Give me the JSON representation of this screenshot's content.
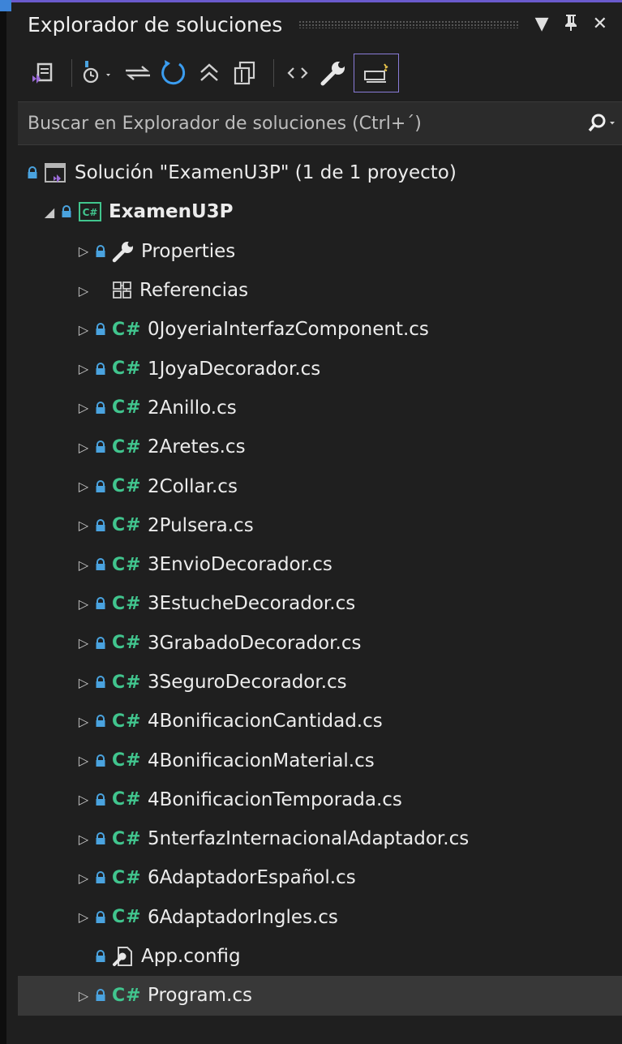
{
  "window": {
    "title": "Explorador de soluciones",
    "controls": {
      "dropdown": "▼",
      "pin": "🖈",
      "close": "✕"
    }
  },
  "toolbar": {
    "buttons": [
      "vs-solution-icon",
      "pending-changes-icon",
      "sync-icon",
      "refresh-icon",
      "collapse-all-icon",
      "show-all-files-icon",
      "code-view-icon",
      "properties-wrench-icon",
      "preview-selected-icon"
    ]
  },
  "search": {
    "placeholder": "Buscar en Explorador de soluciones (Ctrl+´)"
  },
  "tree": {
    "solution": "Solución \"ExamenU3P\"  (1 de 1 proyecto)",
    "project": "ExamenU3P",
    "properties": "Properties",
    "references": "Referencias",
    "cs_prefix": "C#",
    "files": [
      "0JoyeriaInterfazComponent.cs",
      "1JoyaDecorador.cs",
      "2Anillo.cs",
      "2Aretes.cs",
      "2Collar.cs",
      "2Pulsera.cs",
      "3EnvioDecorador.cs",
      "3EstucheDecorador.cs",
      "3GrabadoDecorador.cs",
      "3SeguroDecorador.cs",
      "4BonificacionCantidad.cs",
      "4BonificacionMaterial.cs",
      "4BonificacionTemporada.cs",
      "5nterfazInternacionalAdaptador.cs",
      "6AdaptadorEspañol.cs",
      "6AdaptadorIngles.cs"
    ],
    "config": "App.config",
    "program": "Program.cs"
  },
  "colors": {
    "background": "#1f1f1f",
    "csharp_green": "#41c58e",
    "lock_blue": "#4aa3df",
    "accent_purple": "#8a7cd8"
  }
}
